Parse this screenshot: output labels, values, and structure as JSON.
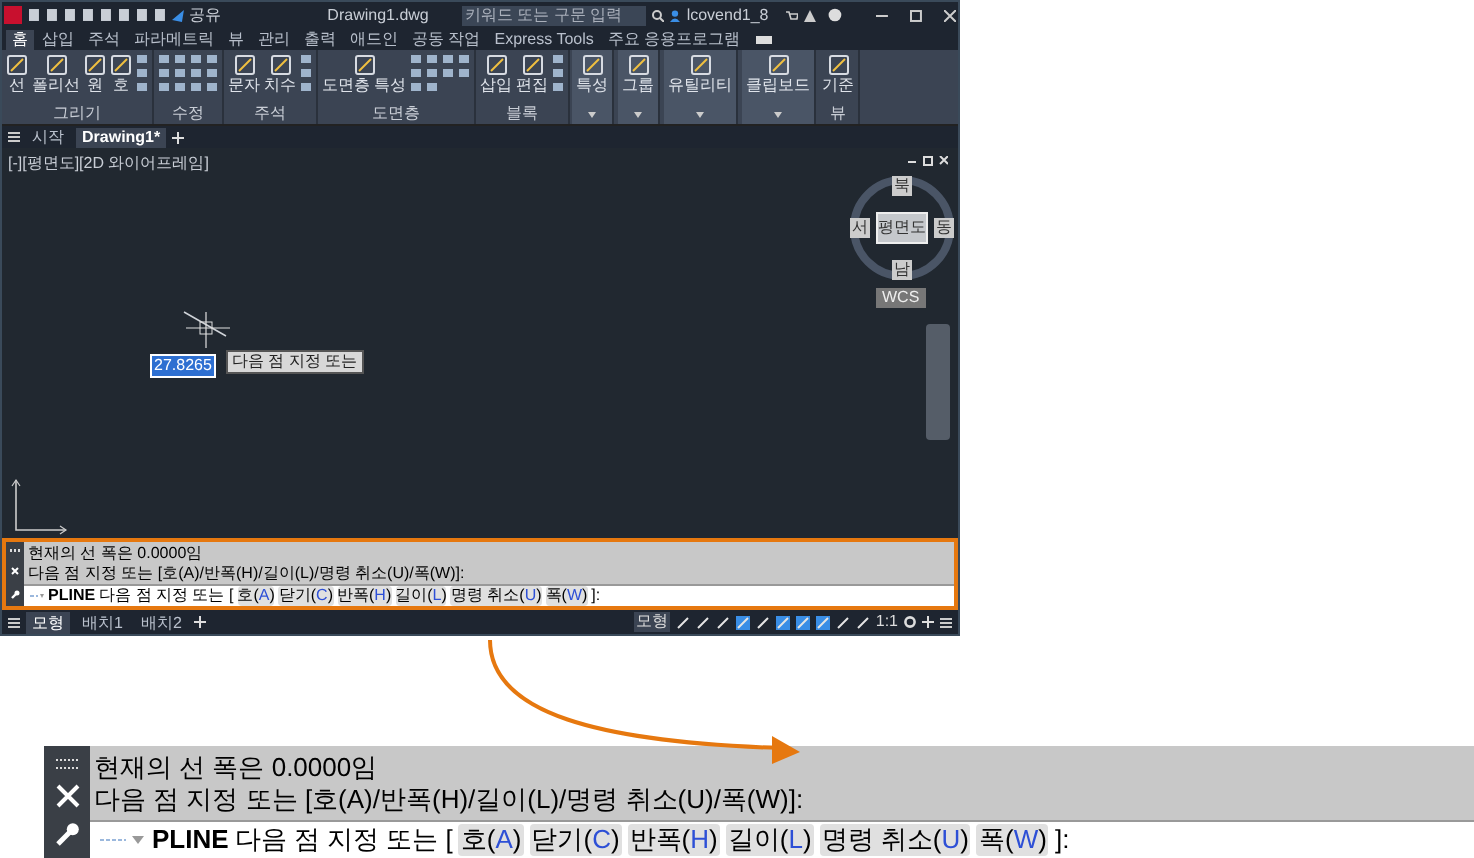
{
  "app": {
    "title": "Drawing1.dwg",
    "share_label": "공유",
    "search": {
      "placeholder": "키워드 또는 구문 입력"
    },
    "user": "lcovend1_8",
    "ribbon_tabs": [
      {
        "label": "홈",
        "selected": true
      },
      {
        "label": "삽입",
        "selected": false
      },
      {
        "label": "주석",
        "selected": false
      },
      {
        "label": "파라메트릭",
        "selected": false
      },
      {
        "label": "뷰",
        "selected": false
      },
      {
        "label": "관리",
        "selected": false
      },
      {
        "label": "출력",
        "selected": false
      },
      {
        "label": "애드인",
        "selected": false
      },
      {
        "label": "공동 작업",
        "selected": false
      },
      {
        "label": "Express Tools",
        "selected": false
      },
      {
        "label": "주요 응용프로그램",
        "selected": false
      }
    ],
    "panels": [
      {
        "title": "그리기",
        "tools": [
          "선",
          "폴리선",
          "원",
          "호"
        ]
      },
      {
        "title": "수정"
      },
      {
        "title": "주석",
        "tools": [
          "문자",
          "치수"
        ]
      },
      {
        "title": "도면층",
        "tools": [
          "도면층 특성"
        ]
      },
      {
        "title": "블록",
        "tools": [
          "삽입",
          "편집"
        ]
      },
      {
        "tools": [
          "특성"
        ]
      },
      {
        "tools": [
          "그룹"
        ]
      },
      {
        "tools": [
          "유틸리티"
        ]
      },
      {
        "tools": [
          "클립보드"
        ]
      },
      {
        "title": "뷰",
        "tools": [
          "기준"
        ]
      }
    ],
    "doc_tabs": [
      {
        "label": "시작",
        "selected": false
      },
      {
        "label": "Drawing1*",
        "selected": true
      }
    ],
    "viewport": {
      "label": "[-][평면도][2D 와이어프레임]",
      "dynamic_input": "27.8265",
      "tooltip": "다음 점 지정 또는",
      "viewcube": {
        "north": "북",
        "west": "서",
        "face": "평면도",
        "east": "동",
        "south": "남",
        "ucs": "WCS"
      }
    },
    "command_line": {
      "history": [
        "현재의 선 폭은 0.0000임",
        "다음 점 지정 또는 [호(A)/반폭(H)/길이(L)/명령 취소(U)/폭(W)]:"
      ],
      "command": "PLINE",
      "prompt": "다음 점 지정 또는 [",
      "options": [
        {
          "before": "호(",
          "key": "A",
          "after": ")"
        },
        {
          "before": "닫기(",
          "key": "C",
          "after": ")"
        },
        {
          "before": "반폭(",
          "key": "H",
          "after": ")"
        },
        {
          "before": "길이(",
          "key": "L",
          "after": ")"
        },
        {
          "before": "명령 취소(",
          "key": "U",
          "after": ")"
        },
        {
          "before": "폭(",
          "key": "W",
          "after": ")"
        }
      ],
      "end": "]:"
    },
    "layout_tabs": [
      {
        "label": "모형",
        "selected": true
      },
      {
        "label": "배치1",
        "selected": false
      },
      {
        "label": "배치2",
        "selected": false
      }
    ],
    "status_bar": {
      "space": "모형",
      "toggles": [
        {
          "on": false
        },
        {
          "on": false
        },
        {
          "on": false
        },
        {
          "on": true
        },
        {
          "on": false
        },
        {
          "on": true
        },
        {
          "on": true
        },
        {
          "on": true
        },
        {
          "on": false
        },
        {
          "on": false
        }
      ],
      "scale": "1:1"
    }
  },
  "zoomed_command_line": {
    "history": [
      "현재의 선 폭은 0.0000임",
      "다음 점 지정 또는 [호(A)/반폭(H)/길이(L)/명령 취소(U)/폭(W)]:"
    ],
    "command": "PLINE",
    "prompt": "다음 점 지정 또는 [",
    "options": [
      {
        "before": "호(",
        "key": "A",
        "after": ")"
      },
      {
        "before": "닫기(",
        "key": "C",
        "after": ")"
      },
      {
        "before": "반폭(",
        "key": "H",
        "after": ")"
      },
      {
        "before": "길이(",
        "key": "L",
        "after": ")"
      },
      {
        "before": "명령 취소(",
        "key": "U",
        "after": ")"
      },
      {
        "before": "폭(",
        "key": "W",
        "after": ")"
      }
    ],
    "end": "]:"
  }
}
